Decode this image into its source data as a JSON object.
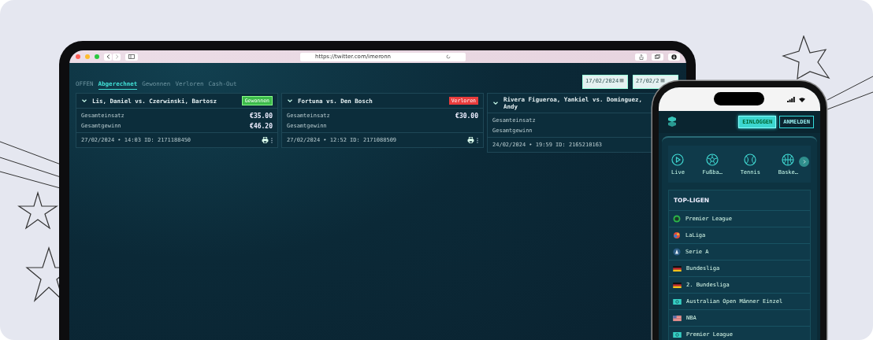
{
  "browser": {
    "url": "https://twitter.com/imeronn"
  },
  "tabs": [
    {
      "label": "OFFEN",
      "selected": false
    },
    {
      "label": "Abgerechnet",
      "selected": true
    },
    {
      "label": "Gewonnen",
      "selected": false
    },
    {
      "label": "Verloren",
      "selected": false
    },
    {
      "label": "Cash-Out",
      "selected": false
    }
  ],
  "date_fields": [
    "17/02/2024",
    "27/02/2"
  ],
  "bets": [
    {
      "title": "Lis, Daniel vs. Czerwinski, Bartosz",
      "status": {
        "label": "Gewonnen",
        "kind": "won"
      },
      "rows": [
        {
          "label": "Gesamteinsatz",
          "amount": "€35.00"
        },
        {
          "label": "Gesamtgewinn",
          "amount": "€46.20"
        }
      ],
      "footer": "27/02/2024 • 14:03 ID: 2171188450"
    },
    {
      "title": "Fortuna vs. Den Bosch",
      "status": {
        "label": "Verloren",
        "kind": "lost"
      },
      "rows": [
        {
          "label": "Gesamteinsatz",
          "amount": "€30.00"
        },
        {
          "label": "Gesamtgewinn"
        }
      ],
      "footer": "27/02/2024 • 12:52 ID: 2171088509"
    },
    {
      "title": "Rivera Figueroa, Yankiel vs. Dominguez, Andy",
      "rows": [
        {
          "label": "Gesamteinsatz"
        },
        {
          "label": "Gesamtgewinn"
        }
      ],
      "footer": "24/02/2024 • 19:59 ID: 2165210163"
    }
  ],
  "phone": {
    "buttons": [
      {
        "label": "EINLOGGEN",
        "selected": true
      },
      {
        "label": "ANMELDEN",
        "selected": false
      }
    ],
    "sports": [
      {
        "label": "Live",
        "kind": "live"
      },
      {
        "label": "Fußba…",
        "kind": "football"
      },
      {
        "label": "Tennis",
        "kind": "tennis"
      },
      {
        "label": "Baske…",
        "kind": "basketball"
      }
    ],
    "leagues_title": "TOP-LIGEN",
    "leagues": [
      {
        "label": "Premier League",
        "kind": "lion"
      },
      {
        "label": "LaLiga",
        "kind": "laliga"
      },
      {
        "label": "Serie A",
        "kind": "seriea"
      },
      {
        "label": "Bundesliga",
        "kind": "de"
      },
      {
        "label": "2. Bundesliga",
        "kind": "de"
      },
      {
        "label": "Australian Open Männer Einzel",
        "kind": "tennis"
      },
      {
        "label": "NBA",
        "kind": "us"
      },
      {
        "label": "Premier League",
        "kind": "tennis"
      }
    ]
  }
}
